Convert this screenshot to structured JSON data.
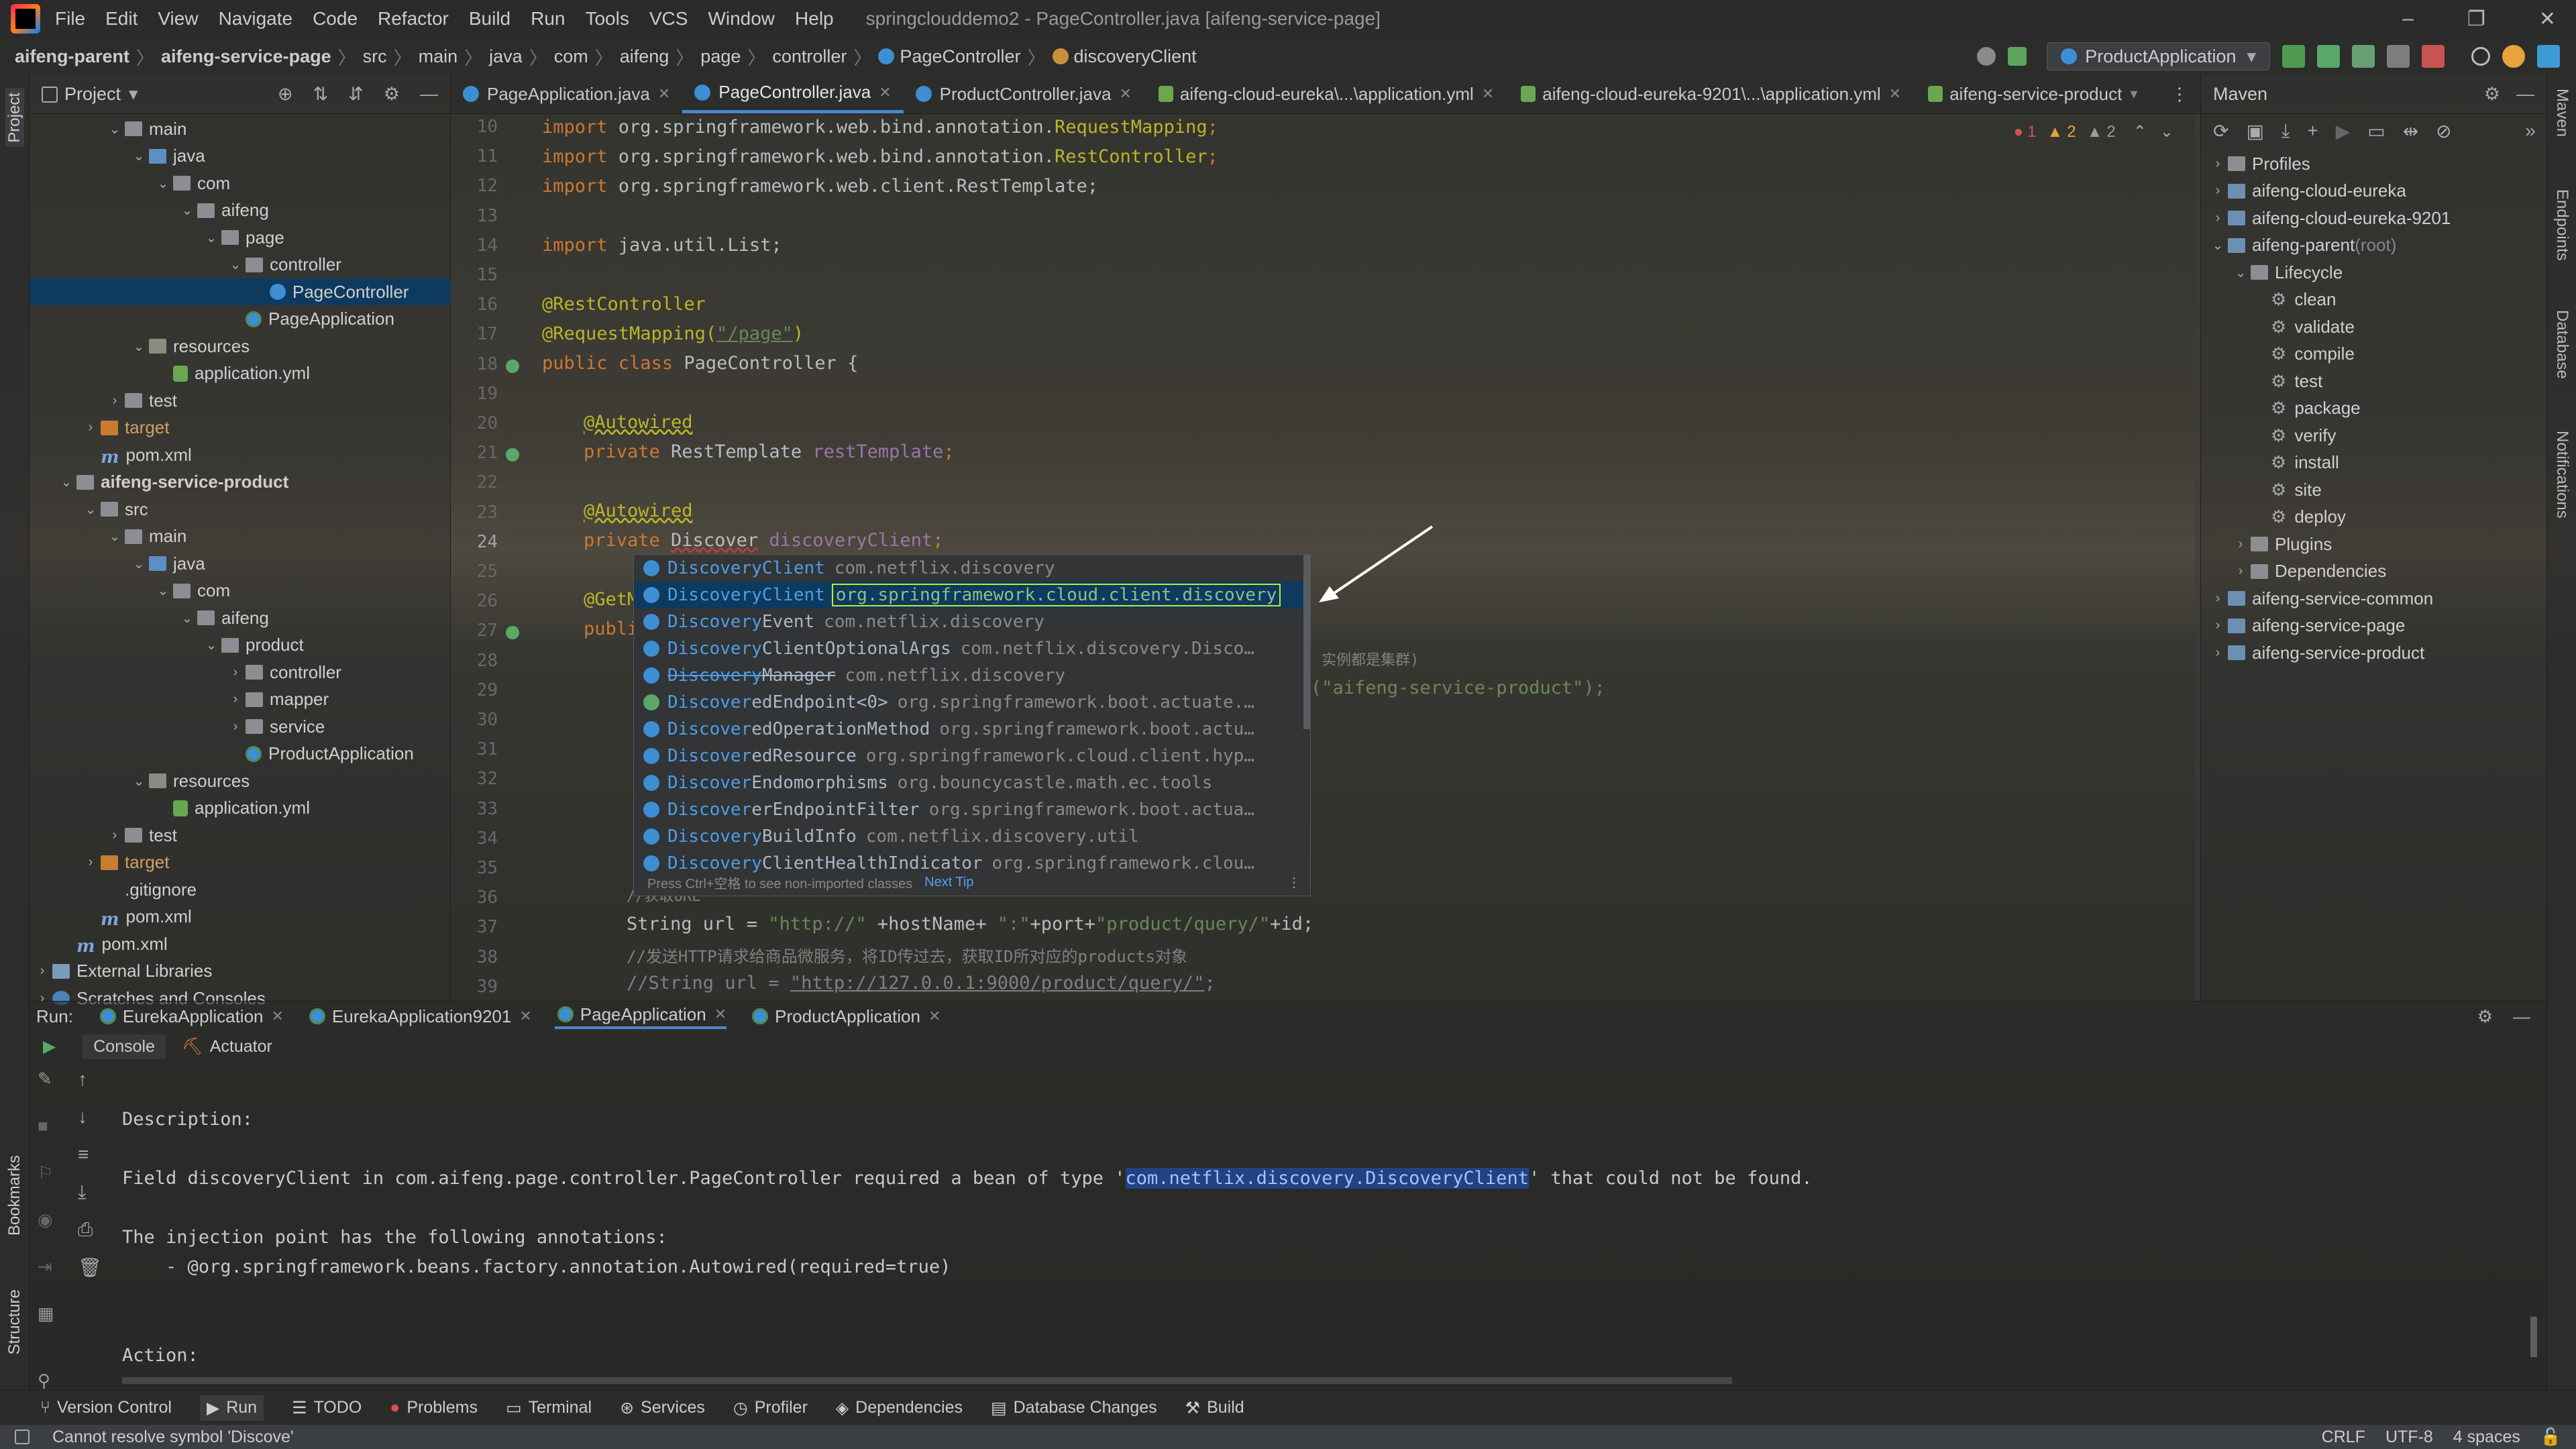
{
  "menubar": {
    "items": [
      "File",
      "Edit",
      "View",
      "Navigate",
      "Code",
      "Refactor",
      "Build",
      "Run",
      "Tools",
      "VCS",
      "Window",
      "Help"
    ],
    "title": "springclouddemo2 - PageController.java [aifeng-service-page]"
  },
  "breadcrumb": [
    "aifeng-parent",
    "aifeng-service-page",
    "src",
    "main",
    "java",
    "com",
    "aifeng",
    "page",
    "controller",
    "PageController",
    "discoveryClient"
  ],
  "run_config": "ProductApplication",
  "project_panel": {
    "title": "Project",
    "tree": [
      {
        "label": "main",
        "indent": 3,
        "tri": "v",
        "icon": "folder"
      },
      {
        "label": "java",
        "indent": 4,
        "tri": "v",
        "icon": "src"
      },
      {
        "label": "com",
        "indent": 5,
        "tri": "v",
        "icon": "folder"
      },
      {
        "label": "aifeng",
        "indent": 6,
        "tri": "v",
        "icon": "folder"
      },
      {
        "label": "page",
        "indent": 7,
        "tri": "v",
        "icon": "folder"
      },
      {
        "label": "controller",
        "indent": 8,
        "tri": "v",
        "icon": "folder"
      },
      {
        "label": "PageController",
        "indent": 9,
        "tri": "",
        "icon": "class",
        "selected": true
      },
      {
        "label": "PageApplication",
        "indent": 8,
        "tri": "",
        "icon": "app"
      },
      {
        "label": "resources",
        "indent": 4,
        "tri": "v",
        "icon": "res"
      },
      {
        "label": "application.yml",
        "indent": 5,
        "tri": "",
        "icon": "yml"
      },
      {
        "label": "test",
        "indent": 3,
        "tri": ">",
        "icon": "folder"
      },
      {
        "label": "target",
        "indent": 2,
        "tri": ">",
        "icon": "target"
      },
      {
        "label": "pom.xml",
        "indent": 2,
        "tri": "",
        "icon": "pom"
      },
      {
        "label": "aifeng-service-product",
        "indent": 1,
        "tri": "v",
        "icon": "folder",
        "bold": true
      },
      {
        "label": "src",
        "indent": 2,
        "tri": "v",
        "icon": "folder"
      },
      {
        "label": "main",
        "indent": 3,
        "tri": "v",
        "icon": "folder"
      },
      {
        "label": "java",
        "indent": 4,
        "tri": "v",
        "icon": "src"
      },
      {
        "label": "com",
        "indent": 5,
        "tri": "v",
        "icon": "folder"
      },
      {
        "label": "aifeng",
        "indent": 6,
        "tri": "v",
        "icon": "folder"
      },
      {
        "label": "product",
        "indent": 7,
        "tri": "v",
        "icon": "folder"
      },
      {
        "label": "controller",
        "indent": 8,
        "tri": ">",
        "icon": "folder"
      },
      {
        "label": "mapper",
        "indent": 8,
        "tri": ">",
        "icon": "folder"
      },
      {
        "label": "service",
        "indent": 8,
        "tri": ">",
        "icon": "folder"
      },
      {
        "label": "ProductApplication",
        "indent": 8,
        "tri": "",
        "icon": "app"
      },
      {
        "label": "resources",
        "indent": 4,
        "tri": "v",
        "icon": "res"
      },
      {
        "label": "application.yml",
        "indent": 5,
        "tri": "",
        "icon": "yml"
      },
      {
        "label": "test",
        "indent": 3,
        "tri": ">",
        "icon": "folder"
      },
      {
        "label": "target",
        "indent": 2,
        "tri": ">",
        "icon": "target"
      },
      {
        "label": ".gitignore",
        "indent": 2,
        "tri": "",
        "icon": "none"
      },
      {
        "label": "pom.xml",
        "indent": 2,
        "tri": "",
        "icon": "pom"
      },
      {
        "label": "pom.xml",
        "indent": 1,
        "tri": "",
        "icon": "pom"
      },
      {
        "label": "External Libraries",
        "indent": 0,
        "tri": ">",
        "icon": "lib"
      },
      {
        "label": "Scratches and Consoles",
        "indent": 0,
        "tri": ">",
        "icon": "scr"
      }
    ]
  },
  "editor_tabs": [
    {
      "label": "PageApplication.java",
      "active": false
    },
    {
      "label": "PageController.java",
      "active": true
    },
    {
      "label": "ProductController.java",
      "active": false
    },
    {
      "label": "aifeng-cloud-eureka\\...\\application.yml",
      "active": false
    },
    {
      "label": "aifeng-cloud-eureka-9201\\...\\application.yml",
      "active": false
    },
    {
      "label": "aifeng-service-product",
      "active": false
    }
  ],
  "inspection": {
    "errors": "1",
    "warnings": "2",
    "weak": "2"
  },
  "line_numbers": [
    "10",
    "11",
    "12",
    "13",
    "14",
    "15",
    "16",
    "17",
    "18",
    "19",
    "20",
    "21",
    "22",
    "23",
    "24",
    "25",
    "26",
    "27",
    "28",
    "29",
    "30",
    "31",
    "32",
    "33",
    "34",
    "35",
    "36",
    "37",
    "38",
    "39"
  ],
  "code": {
    "l10a": "import ",
    "l10b": "org.springframework.web.bind.annotation.",
    "l10c": "RequestMapping",
    "l11a": "import ",
    "l11b": "org.springframework.web.bind.annotation.",
    "l11c": "RestController",
    "l12a": "import ",
    "l12b": "org.springframework.web.client.RestTemplate;",
    "l14a": "import ",
    "l14b": "java.util.List;",
    "l16": "@RestController",
    "l17a": "@RequestMapping(",
    "l17b": "\"/page\"",
    "l17c": ")",
    "l18a": "public class ",
    "l18b": "PageController {",
    "l20": "@Autowired",
    "l21a": "private ",
    "l21b": "RestTemplate ",
    "l21c": "restTemplate",
    "l23": "@Autowired",
    "l24a": "private ",
    "l24b": "Discover",
    "l24c": " discoveryClient",
    "l26": "@GetM",
    "l27": "publi",
    "l28": "实例都是集群)",
    "l29": "(\"aifeng-service-product\");",
    "l36": "//获取URL",
    "l37a": "String url = ",
    "l37b": "\"http://\"",
    "l37c": " +hostName+ ",
    "l37d": "\":\"",
    "l37e": "+port+",
    "l37f": "\"product/query/\"",
    "l37g": "+id;",
    "l38": "//发送HTTP请求给商品微服务，将ID传过去，获取ID所对应的products对象",
    "l39a": "//String url = ",
    "l39b": "\"http://127.0.0.1:9000/product/query/\"",
    "l39c": ";"
  },
  "completion": {
    "items": [
      {
        "match": "DiscoveryClient",
        "rest": "",
        "pkg": "com.netflix.discovery",
        "selected": false
      },
      {
        "match": "DiscoveryClient",
        "rest": "",
        "pkg": "org.springframework.cloud.client.discovery",
        "selected": true
      },
      {
        "match": "Discovery",
        "rest": "Event",
        "pkg": "com.netflix.discovery",
        "selected": false
      },
      {
        "match": "Discovery",
        "rest": "ClientOptionalArgs",
        "pkg": "com.netflix.discovery.Disco…",
        "selected": false
      },
      {
        "match": "Discovery",
        "rest": "Manager",
        "pkg": "com.netflix.discovery",
        "selected": false,
        "strike": true
      },
      {
        "match": "Discover",
        "rest": "edEndpoint<0>",
        "pkg": "org.springframework.boot.actuate.…",
        "selected": false
      },
      {
        "match": "Discover",
        "rest": "edOperationMethod",
        "pkg": "org.springframework.boot.actu…",
        "selected": false
      },
      {
        "match": "Discover",
        "rest": "edResource",
        "pkg": "org.springframework.cloud.client.hyp…",
        "selected": false
      },
      {
        "match": "Discover",
        "rest": "Endomorphisms",
        "pkg": "org.bouncycastle.math.ec.tools",
        "selected": false
      },
      {
        "match": "Discover",
        "rest": "erEndpointFilter",
        "pkg": "org.springframework.boot.actua…",
        "selected": false
      },
      {
        "match": "Discovery",
        "rest": "BuildInfo",
        "pkg": "com.netflix.discovery.util",
        "selected": false
      },
      {
        "match": "Discovery",
        "rest": "ClientHealthIndicator",
        "pkg": "org.springframework.clou…",
        "selected": false
      }
    ],
    "footer": "Press Ctrl+空格 to see non-imported classes",
    "next_tip": "Next Tip"
  },
  "maven": {
    "title": "Maven",
    "items": [
      {
        "label": "Profiles",
        "indent": 0,
        "tri": ">",
        "kind": "folder"
      },
      {
        "label": "aifeng-cloud-eureka",
        "indent": 0,
        "tri": ">",
        "kind": "module"
      },
      {
        "label": "aifeng-cloud-eureka-9201",
        "indent": 0,
        "tri": ">",
        "kind": "module"
      },
      {
        "label": "aifeng-parent",
        "suffix": " (root)",
        "indent": 0,
        "tri": "v",
        "kind": "module"
      },
      {
        "label": "Lifecycle",
        "indent": 1,
        "tri": "v",
        "kind": "folder"
      },
      {
        "label": "clean",
        "indent": 2,
        "tri": "",
        "kind": "gear"
      },
      {
        "label": "validate",
        "indent": 2,
        "tri": "",
        "kind": "gear"
      },
      {
        "label": "compile",
        "indent": 2,
        "tri": "",
        "kind": "gear"
      },
      {
        "label": "test",
        "indent": 2,
        "tri": "",
        "kind": "gear"
      },
      {
        "label": "package",
        "indent": 2,
        "tri": "",
        "kind": "gear"
      },
      {
        "label": "verify",
        "indent": 2,
        "tri": "",
        "kind": "gear"
      },
      {
        "label": "install",
        "indent": 2,
        "tri": "",
        "kind": "gear"
      },
      {
        "label": "site",
        "indent": 2,
        "tri": "",
        "kind": "gear"
      },
      {
        "label": "deploy",
        "indent": 2,
        "tri": "",
        "kind": "gear"
      },
      {
        "label": "Plugins",
        "indent": 1,
        "tri": ">",
        "kind": "folder"
      },
      {
        "label": "Dependencies",
        "indent": 1,
        "tri": ">",
        "kind": "folder"
      },
      {
        "label": "aifeng-service-common",
        "indent": 0,
        "tri": ">",
        "kind": "module"
      },
      {
        "label": "aifeng-service-page",
        "indent": 0,
        "tri": ">",
        "kind": "module"
      },
      {
        "label": "aifeng-service-product",
        "indent": 0,
        "tri": ">",
        "kind": "module"
      }
    ]
  },
  "run_panel": {
    "label": "Run:",
    "tabs": [
      {
        "label": "EurekaApplication",
        "active": false
      },
      {
        "label": "EurekaApplication9201",
        "active": false
      },
      {
        "label": "PageApplication",
        "active": true
      },
      {
        "label": "ProductApplication",
        "active": false
      }
    ],
    "subtabs": [
      "Console",
      "Actuator"
    ],
    "console": {
      "desc": "Description:",
      "field_pre": "Field discoveryClient in com.aifeng.page.controller.PageController required a bean of type '",
      "field_hl": "com.netflix.discovery.DiscoveryClient",
      "field_post": "' that could not be found.",
      "inj": "The injection point has the following annotations:",
      "ann": "    - @org.springframework.beans.factory.annotation.Autowired(required=true)",
      "action": "Action:"
    }
  },
  "left_strip": {
    "project": "Project",
    "bookmarks": "Bookmarks",
    "structure": "Structure"
  },
  "right_strip": {
    "maven": "Maven",
    "endpoints": "Endpoints",
    "database": "Database",
    "notifications": "Notifications"
  },
  "bottom_tools": [
    "Version Control",
    "Run",
    "TODO",
    "Problems",
    "Terminal",
    "Services",
    "Profiler",
    "Dependencies",
    "Database Changes",
    "Build"
  ],
  "status": {
    "message": "Cannot resolve symbol 'Discove'",
    "line_sep": "CRLF",
    "encoding": "UTF-8",
    "indent": "4 spaces"
  }
}
